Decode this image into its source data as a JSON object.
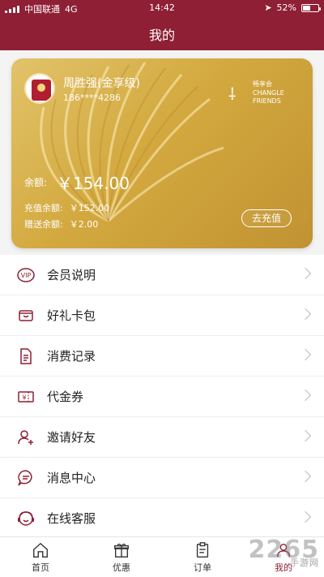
{
  "status": {
    "carrier": "中国联通",
    "network": "4G",
    "time": "14:42",
    "battery": "52%",
    "battery_level": 0.52
  },
  "header": {
    "title": "我的"
  },
  "card": {
    "name": "周胜强(金享级)",
    "phone": "186****4286",
    "brand_title": "畅享会",
    "brand_en_1": "CHANGLE",
    "brand_en_2": "FRIENDS",
    "balance_label": "余额:",
    "balance_value": "￥154.00",
    "recharge_balance_label": "充值余额:",
    "recharge_balance_value": "￥152.00",
    "gift_balance_label": "赠送余额:",
    "gift_balance_value": "￥2.00",
    "recharge_button": "去充值"
  },
  "menu": [
    {
      "label": "会员说明",
      "icon": "vip-icon"
    },
    {
      "label": "好礼卡包",
      "icon": "wallet-icon"
    },
    {
      "label": "消费记录",
      "icon": "document-icon"
    },
    {
      "label": "代金券",
      "icon": "voucher-icon"
    },
    {
      "label": "邀请好友",
      "icon": "add-user-icon"
    },
    {
      "label": "消息中心",
      "icon": "message-icon"
    },
    {
      "label": "在线客服",
      "icon": "customer-service-icon"
    }
  ],
  "tabs": [
    {
      "label": "首页",
      "icon": "home-icon"
    },
    {
      "label": "优惠",
      "icon": "gift-icon"
    },
    {
      "label": "订单",
      "icon": "clipboard-icon"
    },
    {
      "label": "我的",
      "icon": "user-icon",
      "active": true
    }
  ],
  "watermark": {
    "text": "2265",
    "sub": "手游网"
  },
  "colors": {
    "primary": "#8e1f34",
    "gold": "#d3a93f"
  }
}
